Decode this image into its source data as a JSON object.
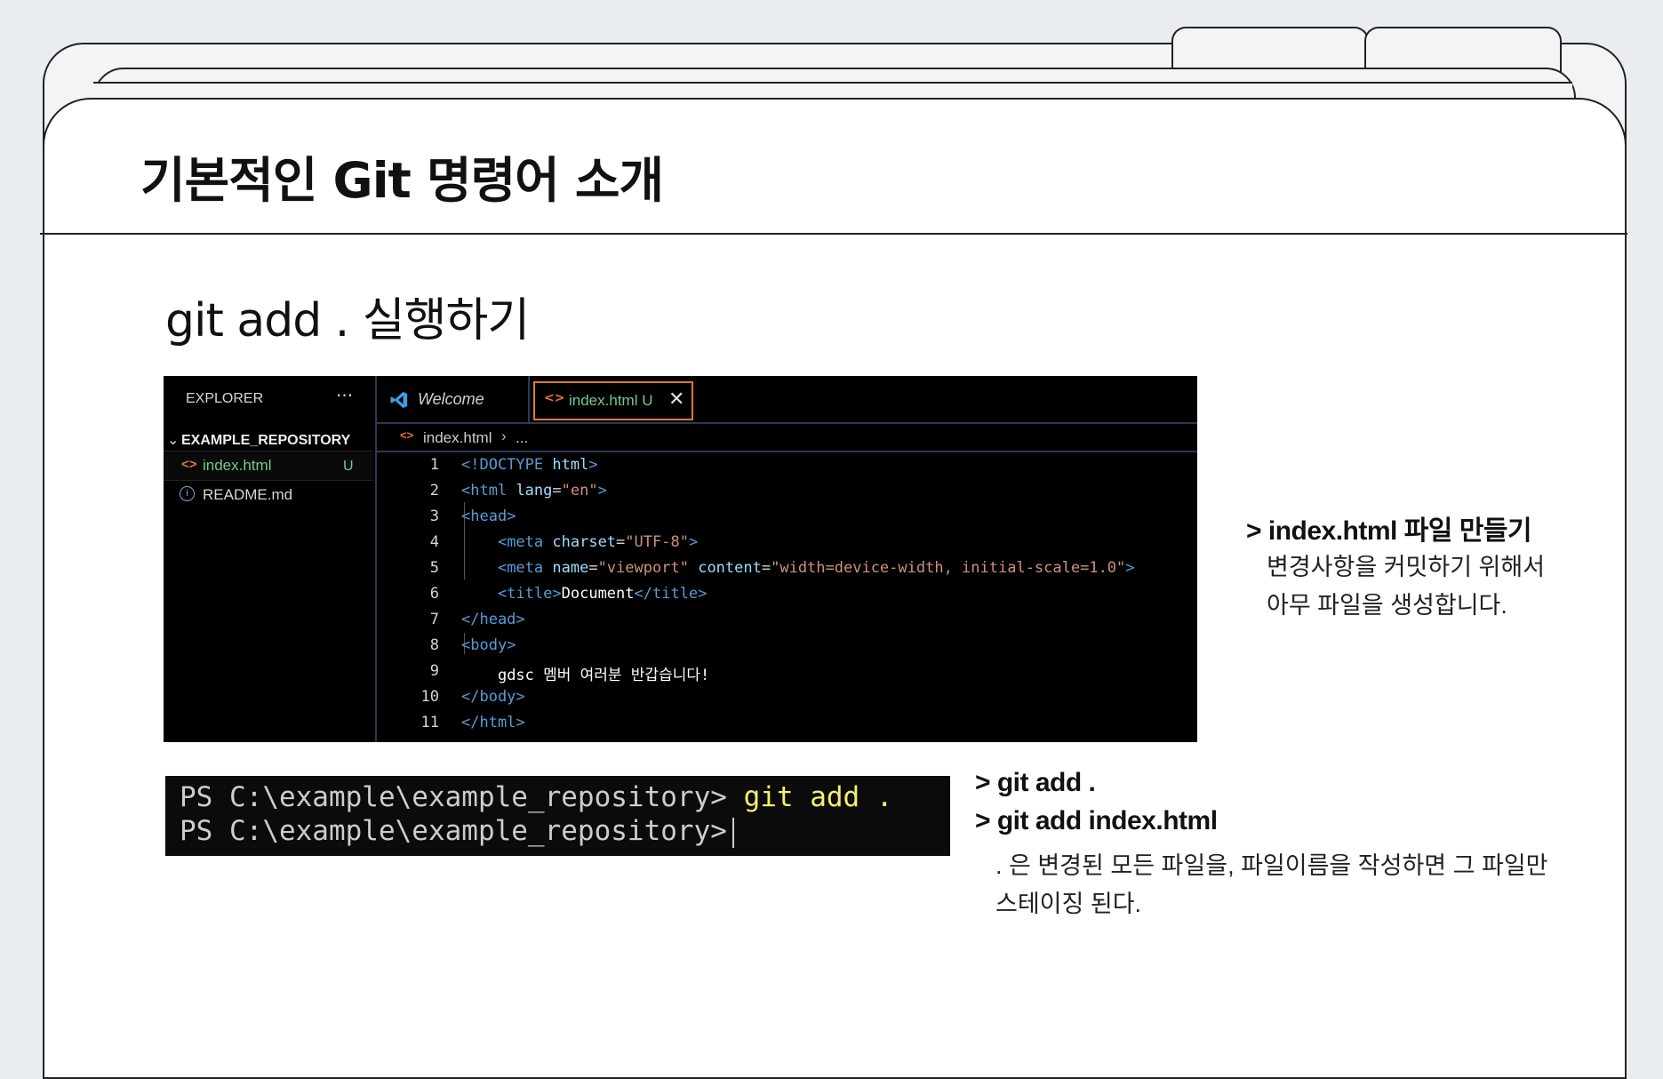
{
  "slide": {
    "title": "기본적인 Git 명령어 소개",
    "subtitle": "git add .   실행하기"
  },
  "explorer": {
    "header": "EXPLORER",
    "more": "···",
    "repo_name": "EXAMPLE_REPOSITORY",
    "files": [
      {
        "name": "index.html",
        "status": "U"
      },
      {
        "name": "README.md",
        "status": ""
      }
    ]
  },
  "tabs": [
    {
      "label": "Welcome"
    },
    {
      "label": "index.html U",
      "close": "✕"
    }
  ],
  "breadcrumb": {
    "file": "index.html",
    "sep": "›",
    "rest": "..."
  },
  "editor": {
    "line_numbers": [
      "1",
      "2",
      "3",
      "4",
      "5",
      "6",
      "7",
      "8",
      "9",
      "10",
      "11"
    ],
    "lines": [
      "<!DOCTYPE html>",
      "<html lang=\"en\">",
      "<head>",
      "    <meta charset=\"UTF-8\">",
      "    <meta name=\"viewport\" content=\"width=device-width, initial-scale=1.0\">",
      "    <title>Document</title>",
      "</head>",
      "<body>",
      "    gdsc 멤버 여러분 반갑습니다!",
      "</body>",
      "</html>"
    ]
  },
  "terminal": {
    "prompt": "PS C:\\example\\example_repository>",
    "command": "git add .",
    "prompt2": "PS C:\\example\\example_repository>"
  },
  "notes": {
    "note1_head": "> index.html 파일 만들기",
    "note1_body1": "변경사항을 커밋하기 위해서",
    "note1_body2": "아무 파일을 생성합니다.",
    "note2_head1": "> git add .",
    "note2_head2": "> git add index.html",
    "note2_body1": ". 은 변경된 모든 파일을, 파일이름을 작성하면 그 파일만",
    "note2_body2": "스테이징 된다."
  },
  "colors": {
    "tag": "#569cd6",
    "attribute": "#9cdcfe",
    "string": "#ce9178",
    "untracked": "#73c991",
    "html_icon": "#e37933",
    "terminal_command": "#f3f070"
  }
}
